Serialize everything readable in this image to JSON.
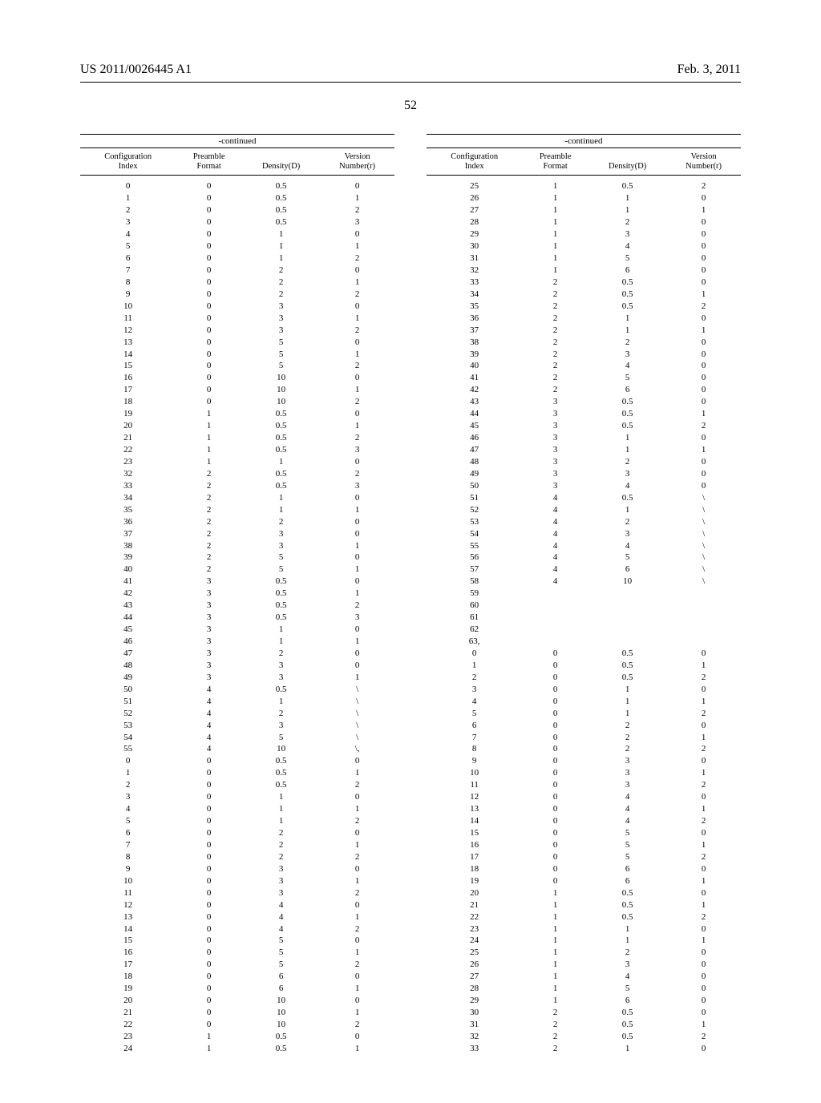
{
  "header": {
    "pubno": "US 2011/0026445 A1",
    "date": "Feb. 3, 2011"
  },
  "pagenum": "52",
  "table_caption": "-continued",
  "headers": {
    "c1": "Configuration",
    "c1b": "Index",
    "c2": "Preamble",
    "c2b": "Format",
    "c3": "Density(D)",
    "c4": "Version",
    "c4b": "Number(r)"
  },
  "left_rows": [
    [
      "0",
      "0",
      "0.5",
      "0"
    ],
    [
      "1",
      "0",
      "0.5",
      "1"
    ],
    [
      "2",
      "0",
      "0.5",
      "2"
    ],
    [
      "3",
      "0",
      "0.5",
      "3"
    ],
    [
      "4",
      "0",
      "1",
      "0"
    ],
    [
      "5",
      "0",
      "1",
      "1"
    ],
    [
      "6",
      "0",
      "1",
      "2"
    ],
    [
      "7",
      "0",
      "2",
      "0"
    ],
    [
      "8",
      "0",
      "2",
      "1"
    ],
    [
      "9",
      "0",
      "2",
      "2"
    ],
    [
      "10",
      "0",
      "3",
      "0"
    ],
    [
      "11",
      "0",
      "3",
      "1"
    ],
    [
      "12",
      "0",
      "3",
      "2"
    ],
    [
      "13",
      "0",
      "5",
      "0"
    ],
    [
      "14",
      "0",
      "5",
      "1"
    ],
    [
      "15",
      "0",
      "5",
      "2"
    ],
    [
      "16",
      "0",
      "10",
      "0"
    ],
    [
      "17",
      "0",
      "10",
      "1"
    ],
    [
      "18",
      "0",
      "10",
      "2"
    ],
    [
      "19",
      "1",
      "0.5",
      "0"
    ],
    [
      "20",
      "1",
      "0.5",
      "1"
    ],
    [
      "21",
      "1",
      "0.5",
      "2"
    ],
    [
      "22",
      "1",
      "0.5",
      "3"
    ],
    [
      "23",
      "1",
      "1",
      "0"
    ],
    [
      "32",
      "2",
      "0.5",
      "2"
    ],
    [
      "33",
      "2",
      "0.5",
      "3"
    ],
    [
      "34",
      "2",
      "1",
      "0"
    ],
    [
      "35",
      "2",
      "1",
      "1"
    ],
    [
      "36",
      "2",
      "2",
      "0"
    ],
    [
      "37",
      "2",
      "3",
      "0"
    ],
    [
      "38",
      "2",
      "3",
      "1"
    ],
    [
      "39",
      "2",
      "5",
      "0"
    ],
    [
      "40",
      "2",
      "5",
      "1"
    ],
    [
      "41",
      "3",
      "0.5",
      "0"
    ],
    [
      "42",
      "3",
      "0.5",
      "1"
    ],
    [
      "43",
      "3",
      "0.5",
      "2"
    ],
    [
      "44",
      "3",
      "0.5",
      "3"
    ],
    [
      "45",
      "3",
      "1",
      "0"
    ],
    [
      "46",
      "3",
      "1",
      "1"
    ],
    [
      "47",
      "3",
      "2",
      "0"
    ],
    [
      "48",
      "3",
      "3",
      "0"
    ],
    [
      "49",
      "3",
      "3",
      "1"
    ],
    [
      "50",
      "4",
      "0.5",
      "\\"
    ],
    [
      "51",
      "4",
      "1",
      "\\"
    ],
    [
      "52",
      "4",
      "2",
      "\\"
    ],
    [
      "53",
      "4",
      "3",
      "\\"
    ],
    [
      "54",
      "4",
      "5",
      "\\"
    ],
    [
      "55",
      "4",
      "10",
      "\\,"
    ],
    [
      "0",
      "0",
      "0.5",
      "0"
    ],
    [
      "1",
      "0",
      "0.5",
      "1"
    ],
    [
      "2",
      "0",
      "0.5",
      "2"
    ],
    [
      "3",
      "0",
      "1",
      "0"
    ],
    [
      "4",
      "0",
      "1",
      "1"
    ],
    [
      "5",
      "0",
      "1",
      "2"
    ],
    [
      "6",
      "0",
      "2",
      "0"
    ],
    [
      "7",
      "0",
      "2",
      "1"
    ],
    [
      "8",
      "0",
      "2",
      "2"
    ],
    [
      "9",
      "0",
      "3",
      "0"
    ],
    [
      "10",
      "0",
      "3",
      "1"
    ],
    [
      "11",
      "0",
      "3",
      "2"
    ],
    [
      "12",
      "0",
      "4",
      "0"
    ],
    [
      "13",
      "0",
      "4",
      "1"
    ],
    [
      "14",
      "0",
      "4",
      "2"
    ],
    [
      "15",
      "0",
      "5",
      "0"
    ],
    [
      "16",
      "0",
      "5",
      "1"
    ],
    [
      "17",
      "0",
      "5",
      "2"
    ],
    [
      "18",
      "0",
      "6",
      "0"
    ],
    [
      "19",
      "0",
      "6",
      "1"
    ],
    [
      "20",
      "0",
      "10",
      "0"
    ],
    [
      "21",
      "0",
      "10",
      "1"
    ],
    [
      "22",
      "0",
      "10",
      "2"
    ],
    [
      "23",
      "1",
      "0.5",
      "0"
    ],
    [
      "24",
      "1",
      "0.5",
      "1"
    ]
  ],
  "right_rows": [
    [
      "25",
      "1",
      "0.5",
      "2"
    ],
    [
      "26",
      "1",
      "1",
      "0"
    ],
    [
      "27",
      "1",
      "1",
      "1"
    ],
    [
      "28",
      "1",
      "2",
      "0"
    ],
    [
      "29",
      "1",
      "3",
      "0"
    ],
    [
      "30",
      "1",
      "4",
      "0"
    ],
    [
      "31",
      "1",
      "5",
      "0"
    ],
    [
      "32",
      "1",
      "6",
      "0"
    ],
    [
      "33",
      "2",
      "0.5",
      "0"
    ],
    [
      "34",
      "2",
      "0.5",
      "1"
    ],
    [
      "35",
      "2",
      "0.5",
      "2"
    ],
    [
      "36",
      "2",
      "1",
      "0"
    ],
    [
      "37",
      "2",
      "1",
      "1"
    ],
    [
      "38",
      "2",
      "2",
      "0"
    ],
    [
      "39",
      "2",
      "3",
      "0"
    ],
    [
      "40",
      "2",
      "4",
      "0"
    ],
    [
      "41",
      "2",
      "5",
      "0"
    ],
    [
      "42",
      "2",
      "6",
      "0"
    ],
    [
      "43",
      "3",
      "0.5",
      "0"
    ],
    [
      "44",
      "3",
      "0.5",
      "1"
    ],
    [
      "45",
      "3",
      "0.5",
      "2"
    ],
    [
      "46",
      "3",
      "1",
      "0"
    ],
    [
      "47",
      "3",
      "1",
      "1"
    ],
    [
      "48",
      "3",
      "2",
      "0"
    ],
    [
      "49",
      "3",
      "3",
      "0"
    ],
    [
      "50",
      "3",
      "4",
      "0"
    ],
    [
      "51",
      "4",
      "0.5",
      "\\"
    ],
    [
      "52",
      "4",
      "1",
      "\\"
    ],
    [
      "53",
      "4",
      "2",
      "\\"
    ],
    [
      "54",
      "4",
      "3",
      "\\"
    ],
    [
      "55",
      "4",
      "4",
      "\\"
    ],
    [
      "56",
      "4",
      "5",
      "\\"
    ],
    [
      "57",
      "4",
      "6",
      "\\"
    ],
    [
      "58",
      "4",
      "10",
      "\\"
    ],
    [
      "59",
      "",
      "",
      ""
    ],
    [
      "60",
      "",
      "",
      ""
    ],
    [
      "61",
      "",
      "",
      ""
    ],
    [
      "62",
      "",
      "",
      ""
    ],
    [
      "63,",
      "",
      "",
      ""
    ],
    [
      "0",
      "0",
      "0.5",
      "0"
    ],
    [
      "1",
      "0",
      "0.5",
      "1"
    ],
    [
      "2",
      "0",
      "0.5",
      "2"
    ],
    [
      "3",
      "0",
      "1",
      "0"
    ],
    [
      "4",
      "0",
      "1",
      "1"
    ],
    [
      "5",
      "0",
      "1",
      "2"
    ],
    [
      "6",
      "0",
      "2",
      "0"
    ],
    [
      "7",
      "0",
      "2",
      "1"
    ],
    [
      "8",
      "0",
      "2",
      "2"
    ],
    [
      "9",
      "0",
      "3",
      "0"
    ],
    [
      "10",
      "0",
      "3",
      "1"
    ],
    [
      "11",
      "0",
      "3",
      "2"
    ],
    [
      "12",
      "0",
      "4",
      "0"
    ],
    [
      "13",
      "0",
      "4",
      "1"
    ],
    [
      "14",
      "0",
      "4",
      "2"
    ],
    [
      "15",
      "0",
      "5",
      "0"
    ],
    [
      "16",
      "0",
      "5",
      "1"
    ],
    [
      "17",
      "0",
      "5",
      "2"
    ],
    [
      "18",
      "0",
      "6",
      "0"
    ],
    [
      "19",
      "0",
      "6",
      "1"
    ],
    [
      "20",
      "1",
      "0.5",
      "0"
    ],
    [
      "21",
      "1",
      "0.5",
      "1"
    ],
    [
      "22",
      "1",
      "0.5",
      "2"
    ],
    [
      "23",
      "1",
      "1",
      "0"
    ],
    [
      "24",
      "1",
      "1",
      "1"
    ],
    [
      "25",
      "1",
      "2",
      "0"
    ],
    [
      "26",
      "1",
      "3",
      "0"
    ],
    [
      "27",
      "1",
      "4",
      "0"
    ],
    [
      "28",
      "1",
      "5",
      "0"
    ],
    [
      "29",
      "1",
      "6",
      "0"
    ],
    [
      "30",
      "2",
      "0.5",
      "0"
    ],
    [
      "31",
      "2",
      "0.5",
      "1"
    ],
    [
      "32",
      "2",
      "0.5",
      "2"
    ],
    [
      "33",
      "2",
      "1",
      "0"
    ]
  ]
}
